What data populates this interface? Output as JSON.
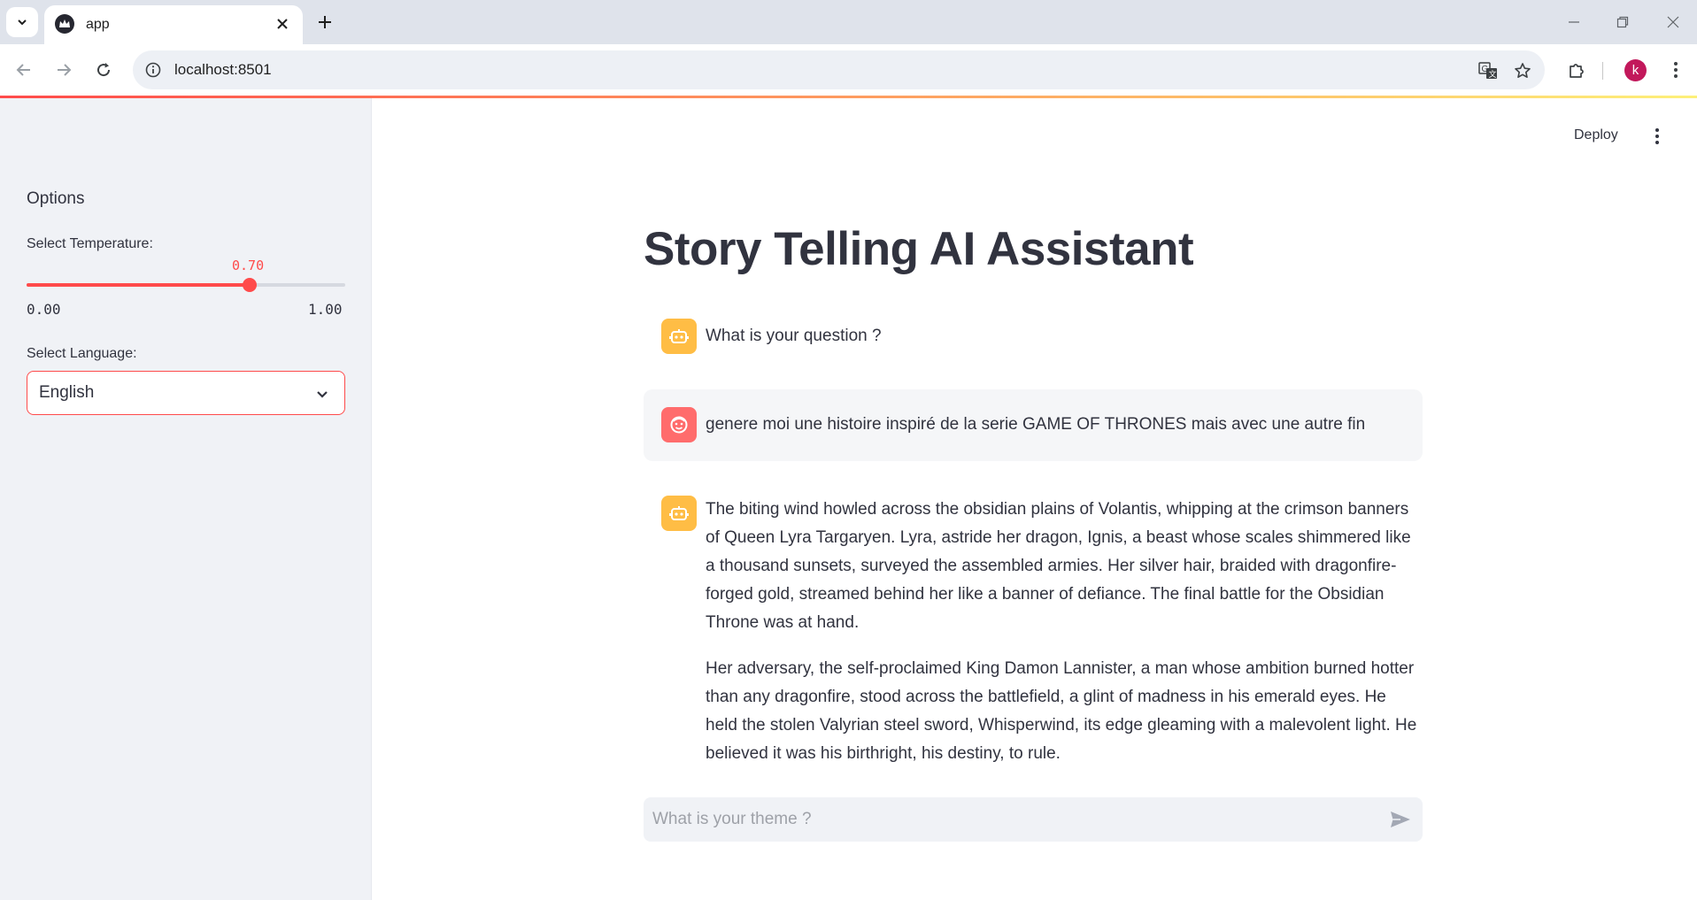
{
  "browser": {
    "tab_title": "app",
    "url": "localhost:8501",
    "profile_initial": "k"
  },
  "sidebar": {
    "heading": "Options",
    "temperature": {
      "label": "Select Temperature:",
      "value_display": "0.70",
      "value": 0.7,
      "min_display": "0.00",
      "max_display": "1.00"
    },
    "language": {
      "label": "Select Language:",
      "selected": "English"
    }
  },
  "header": {
    "deploy_label": "Deploy"
  },
  "main": {
    "title": "Story Telling AI Assistant",
    "messages": [
      {
        "role": "assistant",
        "text": "What is your question ?"
      },
      {
        "role": "user",
        "text": "genere moi une histoire inspiré de la serie GAME OF THRONES mais avec une autre fin"
      },
      {
        "role": "assistant",
        "paragraphs": [
          "The biting wind howled across the obsidian plains of Volantis, whipping at the crimson banners of Queen Lyra Targaryen. Lyra, astride her dragon, Ignis, a beast whose scales shimmered like a thousand sunsets, surveyed the assembled armies. Her silver hair, braided with dragonfire-forged gold, streamed behind her like a banner of defiance. The final battle for the Obsidian Throne was at hand.",
          "Her adversary, the self-proclaimed King Damon Lannister, a man whose ambition burned hotter than any dragonfire, stood across the battlefield, a glint of madness in his emerald eyes. He held the stolen Valyrian steel sword, Whisperwind, its edge gleaming with a malevolent light. He believed it was his birthright, his destiny, to rule."
        ]
      }
    ],
    "chat_input": {
      "placeholder": "What is your theme ?"
    }
  },
  "colors": {
    "accent": "#ff4b4b",
    "assistant_avatar": "#ffbd45",
    "user_avatar": "#ff6c6c",
    "sidebar_bg": "#f0f2f6"
  },
  "icons": {
    "assistant_avatar": "robot-icon",
    "user_avatar": "smiley-face-icon",
    "send": "send-icon"
  }
}
